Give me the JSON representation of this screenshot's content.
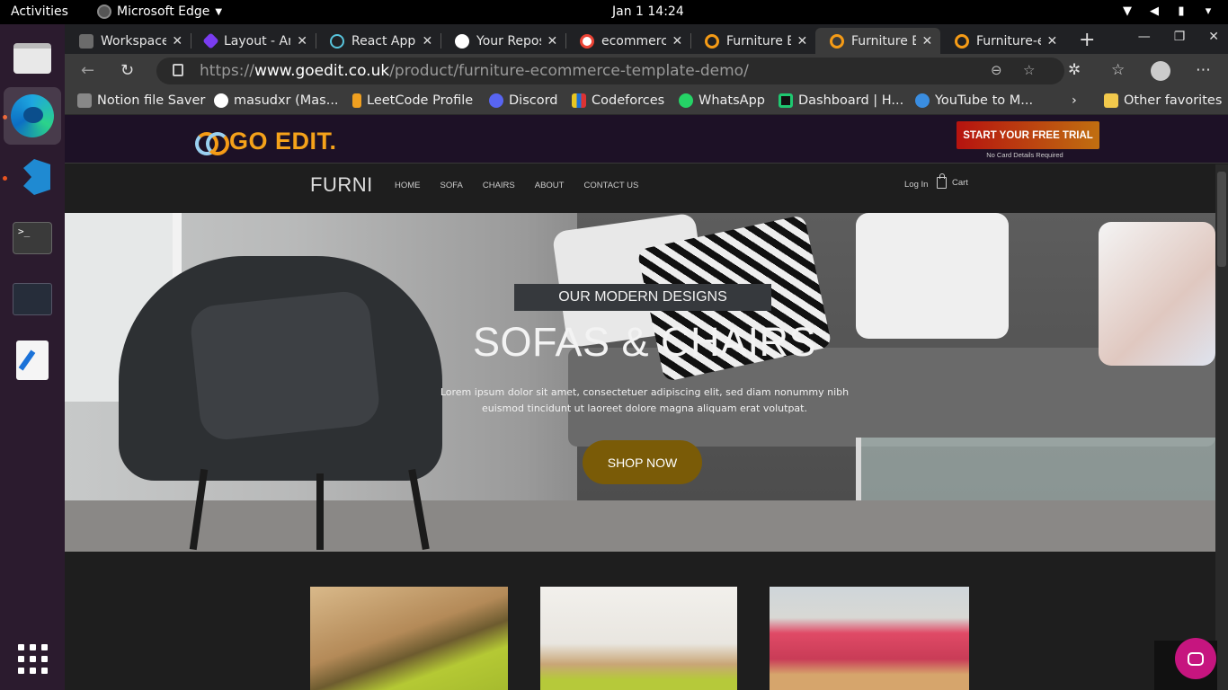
{
  "system": {
    "activities": "Activities",
    "app_name": "Microsoft Edge",
    "clock": "Jan 1  14:24"
  },
  "tabs": [
    {
      "label": "Workspace",
      "icon_color": "#6b6b6b",
      "active": false
    },
    {
      "label": "Layout - An",
      "icon_color": "#7a3cf0",
      "active": false
    },
    {
      "label": "React App",
      "icon_color": "#58c4dc",
      "active": false
    },
    {
      "label": "Your Repos",
      "icon_color": "#ffffff",
      "active": false
    },
    {
      "label": "ecommerce",
      "icon_color": "#ea4335",
      "active": false
    },
    {
      "label": "Furniture E",
      "icon_color": "#f59b16",
      "active": false
    },
    {
      "label": "Furniture E",
      "icon_color": "#f59b16",
      "active": true
    },
    {
      "label": "Furniture-e",
      "icon_color": "#f59b16",
      "active": false
    }
  ],
  "address": {
    "prefix": "https://",
    "domain": "www.goedit.co.uk",
    "path": "/product/furniture-ecommerce-template-demo/"
  },
  "bookmarks": [
    {
      "label": "Notion file Saver",
      "icon_color": "#888888"
    },
    {
      "label": "masudxr (Mas...",
      "icon_color": "#ffffff"
    },
    {
      "label": "LeetCode Profile",
      "icon_color": "#f0a020"
    },
    {
      "label": "Discord",
      "icon_color": "#5865f2"
    },
    {
      "label": "Codeforces",
      "icon_color": "#e8c521"
    },
    {
      "label": "WhatsApp",
      "icon_color": "#25d366"
    },
    {
      "label": "Dashboard | H...",
      "icon_color": "#1ec870"
    },
    {
      "label": "YouTube to M...",
      "icon_color": "#3a8de0"
    }
  ],
  "other_favorites": "Other favorites",
  "site": {
    "logo_text": "GO EDIT.",
    "trial_button": "START YOUR FREE TRIAL",
    "trial_note": "No Card Details Required",
    "brand": "FURNI",
    "menu": [
      "HOME",
      "SOFA",
      "CHAIRS",
      "ABOUT",
      "CONTACT US"
    ],
    "login": "Log In",
    "cart": "Cart",
    "hero": {
      "eyebrow": "OUR MODERN DESIGNS",
      "headline": "SOFAS & CHAIRS",
      "body": "Lorem ipsum dolor sit amet, consectetuer adipiscing elit, sed diam nonummy nibh euismod tincidunt ut laoreet dolore magna aliquam erat volutpat.",
      "cta": "SHOP NOW"
    }
  },
  "colors": {
    "accent_button": "#7a5b07",
    "trial_red": "#b6130f",
    "chat_pink": "#c6157f"
  }
}
